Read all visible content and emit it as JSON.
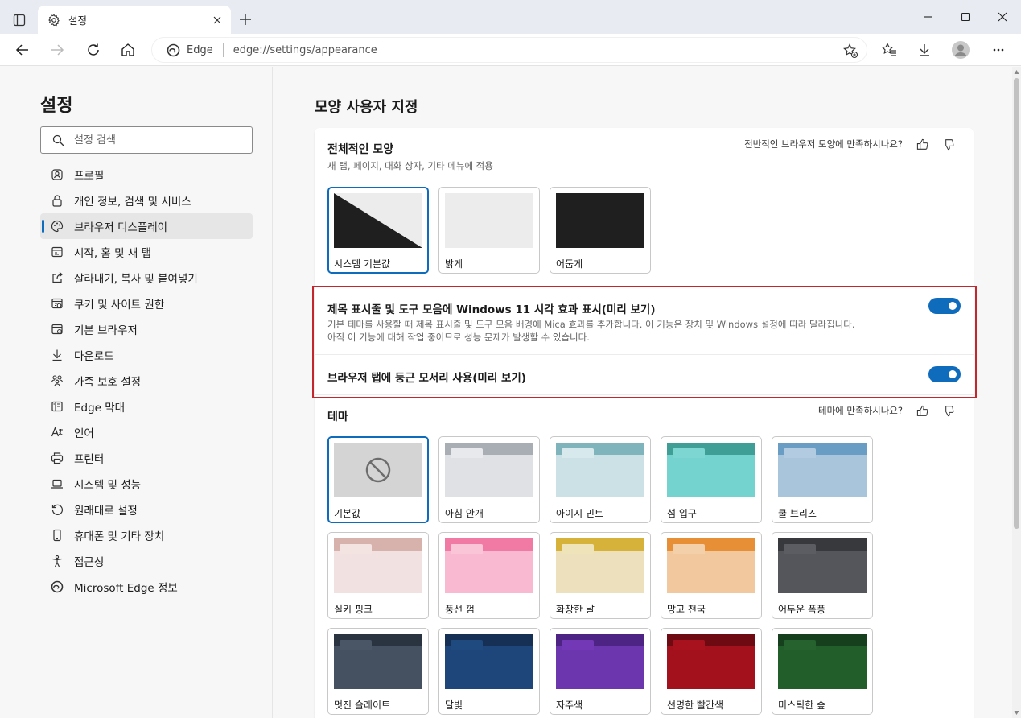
{
  "tab": {
    "title": "설정"
  },
  "address": {
    "site": "Edge",
    "url": "edge://settings/appearance"
  },
  "sidebar": {
    "title": "설정",
    "search_placeholder": "설정 검색",
    "items": [
      {
        "label": "프로필",
        "icon": "profile-icon"
      },
      {
        "label": "개인 정보, 검색 및 서비스",
        "icon": "lock-icon"
      },
      {
        "label": "브라우저 디스플레이",
        "icon": "palette-icon",
        "active": true
      },
      {
        "label": "시작, 홈 및 새 탭",
        "icon": "home-tab-icon"
      },
      {
        "label": "잘라내기, 복사 및 붙여넣기",
        "icon": "share-icon"
      },
      {
        "label": "쿠키 및 사이트 권한",
        "icon": "cookie-icon"
      },
      {
        "label": "기본 브라우저",
        "icon": "browser-icon"
      },
      {
        "label": "다운로드",
        "icon": "download-icon"
      },
      {
        "label": "가족 보호 설정",
        "icon": "family-icon"
      },
      {
        "label": "Edge 막대",
        "icon": "edge-bar-icon"
      },
      {
        "label": "언어",
        "icon": "language-icon"
      },
      {
        "label": "프린터",
        "icon": "printer-icon"
      },
      {
        "label": "시스템 및 성능",
        "icon": "laptop-icon"
      },
      {
        "label": "원래대로 설정",
        "icon": "reset-icon"
      },
      {
        "label": "휴대폰 및 기타 장치",
        "icon": "phone-icon"
      },
      {
        "label": "접근성",
        "icon": "accessibility-icon"
      },
      {
        "label": "Microsoft Edge 정보",
        "icon": "edge-logo-icon"
      }
    ]
  },
  "main": {
    "title": "모양 사용자 지정",
    "overall": {
      "title": "전체적인 모양",
      "subtitle": "새 탭, 페이지, 대화 상자, 기타 메뉴에 적용",
      "feedback_question": "전반적인 브라우저 모양에 만족하시나요?",
      "options": [
        {
          "label": "시스템 기본값",
          "selected": true
        },
        {
          "label": "밝게",
          "selected": false
        },
        {
          "label": "어둡게",
          "selected": false
        }
      ]
    },
    "toggles": [
      {
        "title": "제목 표시줄 및 도구 모음에 Windows 11 시각 효과 표시(미리 보기)",
        "desc_line1": "기본 테마를 사용할 때 제목 표시줄 및 도구 모음 배경에 Mica 효과를 추가합니다. 이 기능은 장치 및 Windows 설정에 따라 달라집니다.",
        "desc_line2": "아직 이 기능에 대해 작업 중이므로 성능 문제가 발생할 수 있습니다.",
        "on": true
      },
      {
        "title": "브라우저 탭에 둥근 모서리 사용(미리 보기)",
        "on": true
      }
    ],
    "theme": {
      "title": "테마",
      "feedback_question": "테마에 만족하시나요?",
      "options": [
        {
          "label": "기본값",
          "selected": true,
          "strip": "#d4d4d4",
          "chip": "#d4d4d4",
          "body": "#d4d4d4",
          "default": true
        },
        {
          "label": "아침 안개",
          "strip": "#a9aeb5",
          "chip": "#e8e9ec",
          "body": "#dfe1e5"
        },
        {
          "label": "아이시 민트",
          "strip": "#7fb4bd",
          "chip": "#d7e9ec",
          "body": "#cbe1e5"
        },
        {
          "label": "섬 입구",
          "strip": "#3f9e96",
          "chip": "#7dd6d2",
          "body": "#74d3cf"
        },
        {
          "label": "쿨 브리즈",
          "strip": "#6a9dc3",
          "chip": "#b2cbe0",
          "body": "#a8c5dc"
        },
        {
          "label": "실키 핑크",
          "strip": "#d7b2ad",
          "chip": "#f3e3e1",
          "body": "#f1e2e1"
        },
        {
          "label": "풍선 껌",
          "strip": "#f07aa3",
          "chip": "#fbc5d8",
          "body": "#f9bad1"
        },
        {
          "label": "화창한 날",
          "strip": "#d6b23a",
          "chip": "#efe3b9",
          "body": "#ede0bc"
        },
        {
          "label": "망고 천국",
          "strip": "#e78f37",
          "chip": "#f3cfaa",
          "body": "#f2c99e"
        },
        {
          "label": "어두운 폭풍",
          "strip": "#38393d",
          "chip": "#5c5d62",
          "body": "#55565b"
        },
        {
          "label": "멋진 슬레이트",
          "strip": "#2a3340",
          "chip": "#4a5566",
          "body": "#455060"
        },
        {
          "label": "달빛",
          "strip": "#152f55",
          "chip": "#1f4a80",
          "body": "#1e467a"
        },
        {
          "label": "자주색",
          "strip": "#4d2384",
          "chip": "#7238b5",
          "body": "#6c36ae"
        },
        {
          "label": "선명한 빨간색",
          "strip": "#6e0a12",
          "chip": "#a8121f",
          "body": "#a3121c"
        },
        {
          "label": "미스틱한 숲",
          "strip": "#153f1d",
          "chip": "#25622d",
          "body": "#225e2a"
        }
      ]
    }
  },
  "colors": {
    "accent": "#0f6cbd",
    "highlight_border": "#c4262e"
  }
}
